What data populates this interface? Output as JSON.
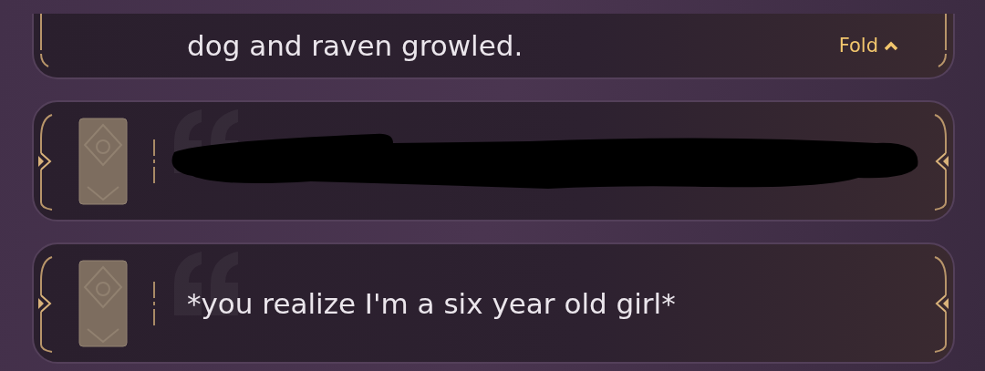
{
  "messages": [
    {
      "kind": "expanded",
      "text": "dog and raven growled.",
      "fold_label": "Fold"
    },
    {
      "kind": "redacted"
    },
    {
      "kind": "normal",
      "text": "*you realize I'm a six year old girl*"
    }
  ]
}
